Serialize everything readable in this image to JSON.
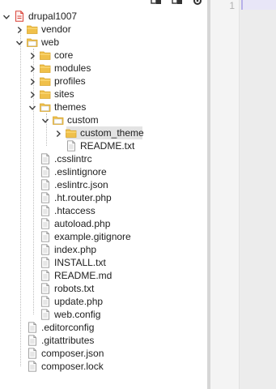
{
  "toolbar": {
    "icons": [
      "collapse-all-icon",
      "link-with-editor-icon",
      "settings-icon"
    ]
  },
  "editor": {
    "line_number": "1"
  },
  "tree": [
    {
      "label": "drupal1007",
      "type": "project",
      "depth": 0,
      "expanded": true
    },
    {
      "label": "vendor",
      "type": "folder",
      "depth": 1,
      "expanded": false
    },
    {
      "label": "web",
      "type": "folder",
      "depth": 1,
      "expanded": true
    },
    {
      "label": "core",
      "type": "folder",
      "depth": 2,
      "expanded": false
    },
    {
      "label": "modules",
      "type": "folder",
      "depth": 2,
      "expanded": false
    },
    {
      "label": "profiles",
      "type": "folder",
      "depth": 2,
      "expanded": false
    },
    {
      "label": "sites",
      "type": "folder",
      "depth": 2,
      "expanded": false
    },
    {
      "label": "themes",
      "type": "folder",
      "depth": 2,
      "expanded": true
    },
    {
      "label": "custom",
      "type": "folder",
      "depth": 3,
      "expanded": true
    },
    {
      "label": "custom_theme",
      "type": "folder",
      "depth": 4,
      "expanded": false,
      "selected": true
    },
    {
      "label": "README.txt",
      "type": "file",
      "depth": 4
    },
    {
      "label": ".csslintrc",
      "type": "file",
      "depth": 2
    },
    {
      "label": ".eslintignore",
      "type": "file",
      "depth": 2
    },
    {
      "label": ".eslintrc.json",
      "type": "file",
      "depth": 2
    },
    {
      "label": ".ht.router.php",
      "type": "file",
      "depth": 2
    },
    {
      "label": ".htaccess",
      "type": "file",
      "depth": 2
    },
    {
      "label": "autoload.php",
      "type": "file",
      "depth": 2
    },
    {
      "label": "example.gitignore",
      "type": "file",
      "depth": 2
    },
    {
      "label": "index.php",
      "type": "file",
      "depth": 2
    },
    {
      "label": "INSTALL.txt",
      "type": "file",
      "depth": 2
    },
    {
      "label": "README.md",
      "type": "file",
      "depth": 2
    },
    {
      "label": "robots.txt",
      "type": "file",
      "depth": 2
    },
    {
      "label": "update.php",
      "type": "file",
      "depth": 2
    },
    {
      "label": "web.config",
      "type": "file",
      "depth": 2
    },
    {
      "label": ".editorconfig",
      "type": "file",
      "depth": 1
    },
    {
      "label": ".gitattributes",
      "type": "file",
      "depth": 1
    },
    {
      "label": "composer.json",
      "type": "file",
      "depth": 1
    },
    {
      "label": "composer.lock",
      "type": "file",
      "depth": 1
    }
  ],
  "colors": {
    "folder": "#f0c04a",
    "folder_dark": "#d9a62e",
    "folder_open_inner": "#ffe48a",
    "project": "#d9443a",
    "selection": "#e3e3e3",
    "text": "#1e1e1e"
  }
}
